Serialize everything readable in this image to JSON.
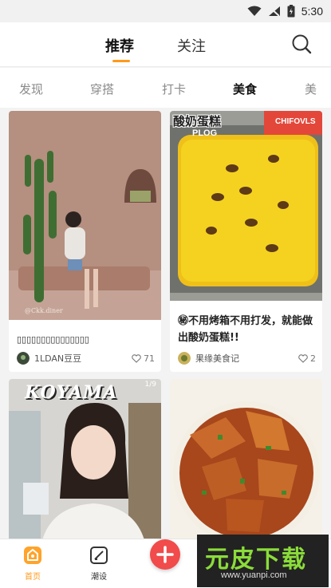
{
  "status_bar": {
    "time": "5:30"
  },
  "top_nav": {
    "tabs": [
      {
        "label": "推荐",
        "active": true
      },
      {
        "label": "关注",
        "active": false
      }
    ]
  },
  "sub_tabs": [
    {
      "label": "发现",
      "active": false
    },
    {
      "label": "穿搭",
      "active": false
    },
    {
      "label": "打卡",
      "active": false
    },
    {
      "label": "美食",
      "active": true
    },
    {
      "label": "美",
      "active": false
    }
  ],
  "feed": {
    "cards": [
      {
        "title": "▯▯▯▯▯▯▯▯▯▯▯▯▯▯▯",
        "author": "1LDAN豆豆",
        "likes": "71"
      },
      {
        "title": "㊙不用烤箱不用打发，就能做出酸奶蛋糕!!",
        "author": "果缘美食记",
        "likes": "2",
        "image_text_main": "酸奶蛋糕",
        "image_text_sub": "PLOG",
        "image_text_corner": "CHIFOVLS"
      },
      {
        "title": "",
        "author": "",
        "likes": "",
        "image_text_main": "KOYAMA",
        "image_text_corner": "1/9"
      },
      {
        "title": "",
        "author": "",
        "likes": ""
      }
    ]
  },
  "bottom_nav": {
    "items": [
      {
        "label": "首页",
        "active": true
      },
      {
        "label": "潮设",
        "active": false
      }
    ]
  },
  "watermark": {
    "main": "元皮下载",
    "sub": "www.yuanpi.com"
  },
  "colors": {
    "accent": "#ff9a1a",
    "fab": "#f14b4b",
    "watermark_green": "#8bdc3a"
  }
}
